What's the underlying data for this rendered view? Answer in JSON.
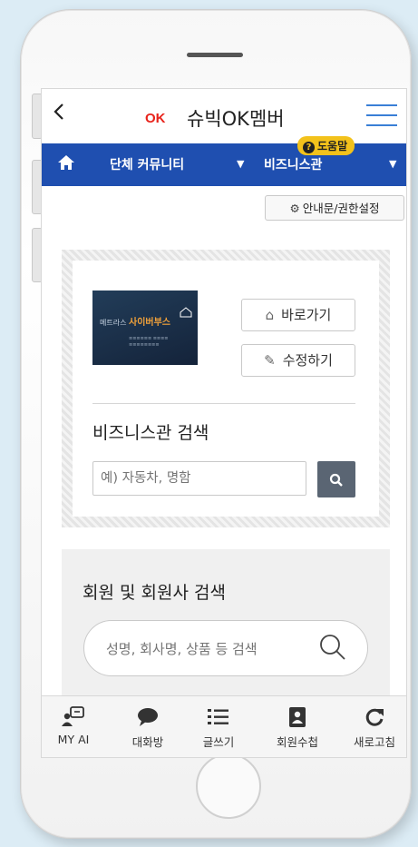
{
  "topbar": {
    "back_icon": "chevron-left-icon",
    "logo": "OK",
    "title": "슈빅OK멤버",
    "menu_icon": "hamburger-icon"
  },
  "navbar": {
    "home_icon": "home-icon",
    "community": "단체 커뮤니티",
    "business": "비즈니스관",
    "help": "도움말",
    "help_icon": "question-icon",
    "colors": {
      "nav_bg": "#1f4fb0",
      "help_bg": "#f3c21b"
    }
  },
  "permissions_button": "안내문/권한설정",
  "business_card": {
    "thumbnail_brand_prefix": "메트라스",
    "thumbnail_brand": "사이버부스",
    "shortcut_button": "바로가기",
    "edit_button": "수정하기",
    "search_title": "비즈니스관 검색",
    "search_placeholder": "예) 자동차, 명함"
  },
  "member_search": {
    "title": "회원 및 회원사 검색",
    "placeholder": "성명, 회사명, 상품 등 검색"
  },
  "tabbar": {
    "items": [
      {
        "label": "MY AI",
        "icon": "ai-chat-icon"
      },
      {
        "label": "대화방",
        "icon": "speech-bubble-icon"
      },
      {
        "label": "글쓰기",
        "icon": "list-icon"
      },
      {
        "label": "회원수첩",
        "icon": "address-book-icon"
      },
      {
        "label": "새로고침",
        "icon": "refresh-icon"
      }
    ]
  }
}
